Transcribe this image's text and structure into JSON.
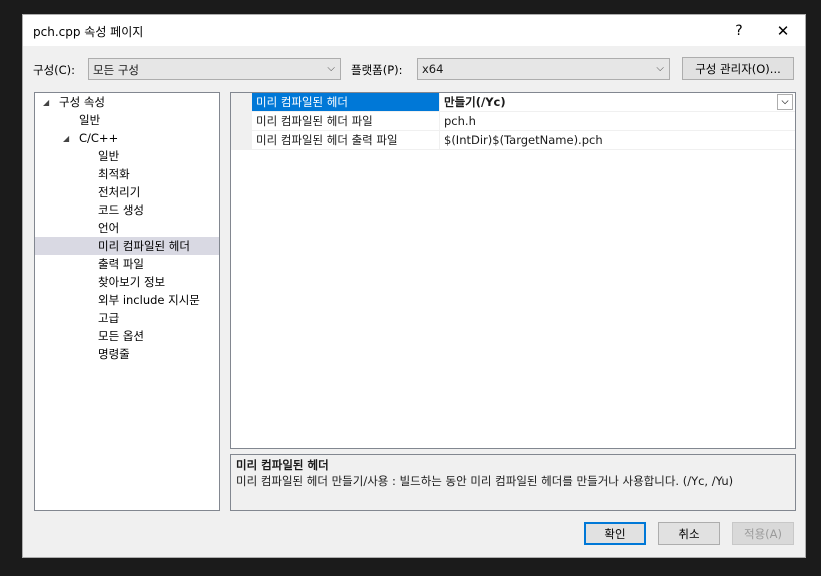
{
  "window": {
    "title": "pch.cpp 속성 페이지",
    "help": "?",
    "close": "✕"
  },
  "toolbar": {
    "config_label": "구성(C):",
    "config_value": "모든 구성",
    "platform_label": "플랫폼(P):",
    "platform_value": "x64",
    "manager_button": "구성 관리자(O)..."
  },
  "tree": {
    "root": "구성 속성",
    "general": "일반",
    "cpp": "C/C++",
    "children": [
      "일반",
      "최적화",
      "전처리기",
      "코드 생성",
      "언어",
      "미리 컴파일된 헤더",
      "출력 파일",
      "찾아보기 정보",
      "외부 include 지시문",
      "고급",
      "모든 옵션",
      "명령줄"
    ],
    "selected": "미리 컴파일된 헤더"
  },
  "grid": {
    "rows": [
      {
        "name": "미리 컴파일된 헤더",
        "value": "만들기(/Yc)"
      },
      {
        "name": "미리 컴파일된 헤더 파일",
        "value": "pch.h"
      },
      {
        "name": "미리 컴파일된 헤더 출력 파일",
        "value": "$(IntDir)$(TargetName).pch"
      }
    ]
  },
  "description": {
    "title": "미리 컴파일된 헤더",
    "body": "미리 컴파일된 헤더 만들기/사용 : 빌드하는 동안 미리 컴파일된 헤더를 만들거나 사용합니다.     (/Yc, /Yu)"
  },
  "footer": {
    "ok": "확인",
    "cancel": "취소",
    "apply": "적용(A)"
  },
  "colors": {
    "accent": "#0078d7",
    "tree_selected": "#d9d9e3"
  }
}
